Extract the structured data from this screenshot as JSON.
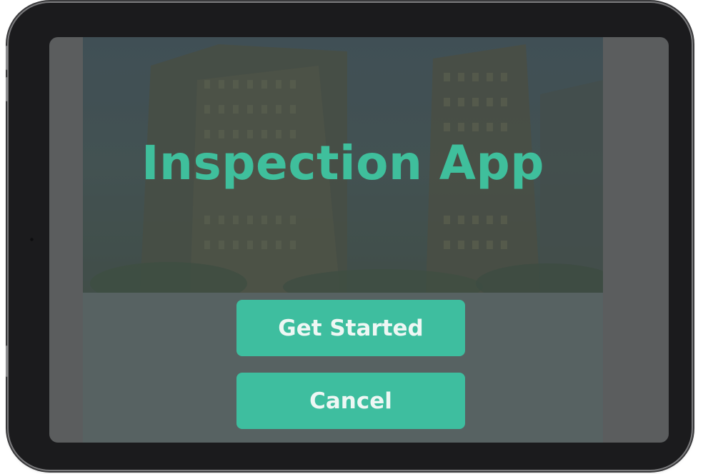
{
  "app": {
    "title": "Inspection App"
  },
  "buttons": {
    "get_started": "Get Started",
    "cancel": "Cancel"
  },
  "colors": {
    "accent": "#3ebe9f",
    "title": "#3fbf9c",
    "bezel": "#1b1b1d",
    "panel": "#576262"
  },
  "hero": {
    "image": "city-buildings-background"
  }
}
